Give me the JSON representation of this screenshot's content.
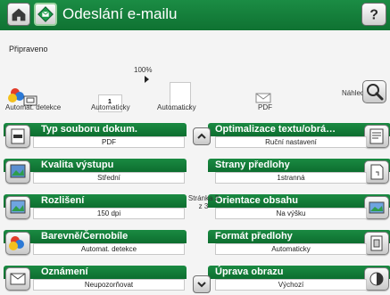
{
  "header": {
    "title": "Odeslání e-mailu"
  },
  "status": {
    "text": "Připraveno"
  },
  "preview": {
    "zoom": "100%",
    "color_mode_label": "Automat. detekce",
    "page_size_label": "Automaticky",
    "orientation_label": "Automaticky",
    "file_type_label": "PDF",
    "preview_label": "Náhled"
  },
  "options": {
    "left": [
      {
        "title": "Typ souboru dokum.",
        "value": "PDF"
      },
      {
        "title": "Kvalita výstupu",
        "value": "Střední"
      },
      {
        "title": "Rozlišení",
        "value": "150 dpi"
      },
      {
        "title": "Barevně/Černobíle",
        "value": "Automat. detekce"
      },
      {
        "title": "Oznámení",
        "value": "Neupozorňovat"
      }
    ],
    "right": [
      {
        "title": "Optimalizace textu/obrá…",
        "value": "Ruční nastavení"
      },
      {
        "title": "Strany předlohy",
        "value": "1stranná"
      },
      {
        "title": "Orientace obsahu",
        "value": "Na výšku"
      },
      {
        "title": "Formát předlohy",
        "value": "Automaticky"
      },
      {
        "title": "Úprava obrazu",
        "value": "Výchozí"
      }
    ]
  },
  "pager": {
    "line1": "Stránka 2",
    "line2": "z 3"
  },
  "icons": {
    "home": "home-icon",
    "app": "email-app-icon",
    "help": "help-icon",
    "preview": "magnifier-icon"
  },
  "colors": {
    "header_green": "#148a3f",
    "tile_green": "#11763a"
  }
}
